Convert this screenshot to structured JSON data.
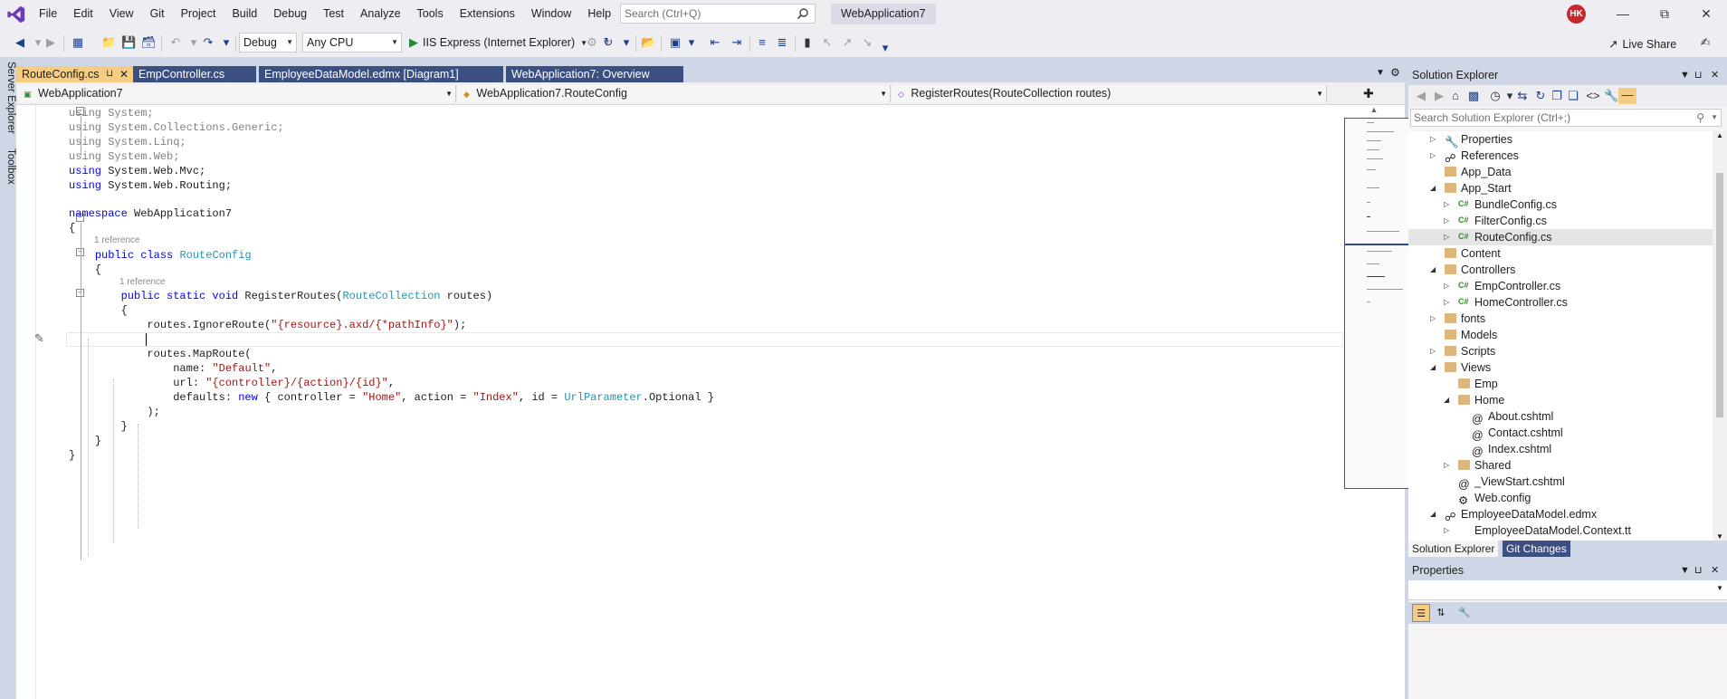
{
  "menubar": {
    "items": [
      "File",
      "Edit",
      "View",
      "Git",
      "Project",
      "Build",
      "Debug",
      "Test",
      "Analyze",
      "Tools",
      "Extensions",
      "Window",
      "Help"
    ],
    "search_placeholder": "Search (Ctrl+Q)",
    "solution_name": "WebApplication7",
    "user_initials": "HK"
  },
  "toolbar": {
    "configuration": "Debug",
    "platform": "Any CPU",
    "run_target": "IIS Express (Internet Explorer)",
    "live_share": "Live Share"
  },
  "side_tabs": [
    "Server Explorer",
    "Toolbox"
  ],
  "editor_tabs": [
    {
      "label": "RouteConfig.cs",
      "active": true
    },
    {
      "label": "EmpController.cs",
      "active": false
    },
    {
      "label": "EmployeeDataModel.edmx [Diagram1]",
      "active": false
    },
    {
      "label": "WebApplication7: Overview",
      "active": false
    }
  ],
  "navbar": {
    "project": "WebApplication7",
    "type": "WebApplication7.RouteConfig",
    "member": "RegisterRoutes(RouteCollection routes)"
  },
  "code": {
    "lens_class": "1 reference",
    "lens_method": "1 reference"
  },
  "solution_explorer": {
    "title": "Solution Explorer",
    "search_placeholder": "Search Solution Explorer (Ctrl+;)",
    "tree": [
      {
        "label": "Properties",
        "level": 1,
        "expander": "collapsed",
        "icon": "wrench-icon"
      },
      {
        "label": "References",
        "level": 1,
        "expander": "collapsed",
        "icon": "references-icon"
      },
      {
        "label": "App_Data",
        "level": 1,
        "expander": "none",
        "icon": "folder-icon"
      },
      {
        "label": "App_Start",
        "level": 1,
        "expander": "expanded",
        "icon": "folder-open-icon"
      },
      {
        "label": "BundleConfig.cs",
        "level": 2,
        "expander": "collapsed",
        "icon": "csharp-file-icon"
      },
      {
        "label": "FilterConfig.cs",
        "level": 2,
        "expander": "collapsed",
        "icon": "csharp-file-icon"
      },
      {
        "label": "RouteConfig.cs",
        "level": 2,
        "expander": "collapsed",
        "icon": "csharp-file-icon",
        "selected": true
      },
      {
        "label": "Content",
        "level": 1,
        "expander": "none",
        "icon": "folder-icon"
      },
      {
        "label": "Controllers",
        "level": 1,
        "expander": "expanded",
        "icon": "folder-open-icon"
      },
      {
        "label": "EmpController.cs",
        "level": 2,
        "expander": "collapsed",
        "icon": "csharp-file-icon"
      },
      {
        "label": "HomeController.cs",
        "level": 2,
        "expander": "collapsed",
        "icon": "csharp-file-icon"
      },
      {
        "label": "fonts",
        "level": 1,
        "expander": "collapsed",
        "icon": "folder-icon"
      },
      {
        "label": "Models",
        "level": 1,
        "expander": "none",
        "icon": "folder-icon"
      },
      {
        "label": "Scripts",
        "level": 1,
        "expander": "collapsed",
        "icon": "folder-icon"
      },
      {
        "label": "Views",
        "level": 1,
        "expander": "expanded",
        "icon": "folder-open-icon"
      },
      {
        "label": "Emp",
        "level": 2,
        "expander": "none",
        "icon": "folder-icon"
      },
      {
        "label": "Home",
        "level": 2,
        "expander": "expanded",
        "icon": "folder-open-icon"
      },
      {
        "label": "About.cshtml",
        "level": 3,
        "expander": "none",
        "icon": "razor-file-icon"
      },
      {
        "label": "Contact.cshtml",
        "level": 3,
        "expander": "none",
        "icon": "razor-file-icon"
      },
      {
        "label": "Index.cshtml",
        "level": 3,
        "expander": "none",
        "icon": "razor-file-icon"
      },
      {
        "label": "Shared",
        "level": 2,
        "expander": "collapsed",
        "icon": "folder-icon"
      },
      {
        "label": "_ViewStart.cshtml",
        "level": 2,
        "expander": "none",
        "icon": "razor-file-icon"
      },
      {
        "label": "Web.config",
        "level": 2,
        "expander": "none",
        "icon": "config-file-icon"
      },
      {
        "label": "EmployeeDataModel.edmx",
        "level": 1,
        "expander": "expanded",
        "icon": "edmx-icon"
      },
      {
        "label": "EmployeeDataModel.Context.tt",
        "level": 2,
        "expander": "collapsed",
        "icon": "template-file-icon"
      }
    ],
    "bottom_tabs": [
      {
        "label": "Solution Explorer",
        "active": true
      },
      {
        "label": "Git Changes",
        "active": false
      }
    ]
  },
  "properties": {
    "title": "Properties"
  },
  "colors": {
    "accent_tab": "#f5cc84",
    "inactive_tab": "#3b4f81",
    "frame": "#cfd6e5",
    "keyword": "#0000ff",
    "type": "#2b91af",
    "string": "#a31515"
  }
}
